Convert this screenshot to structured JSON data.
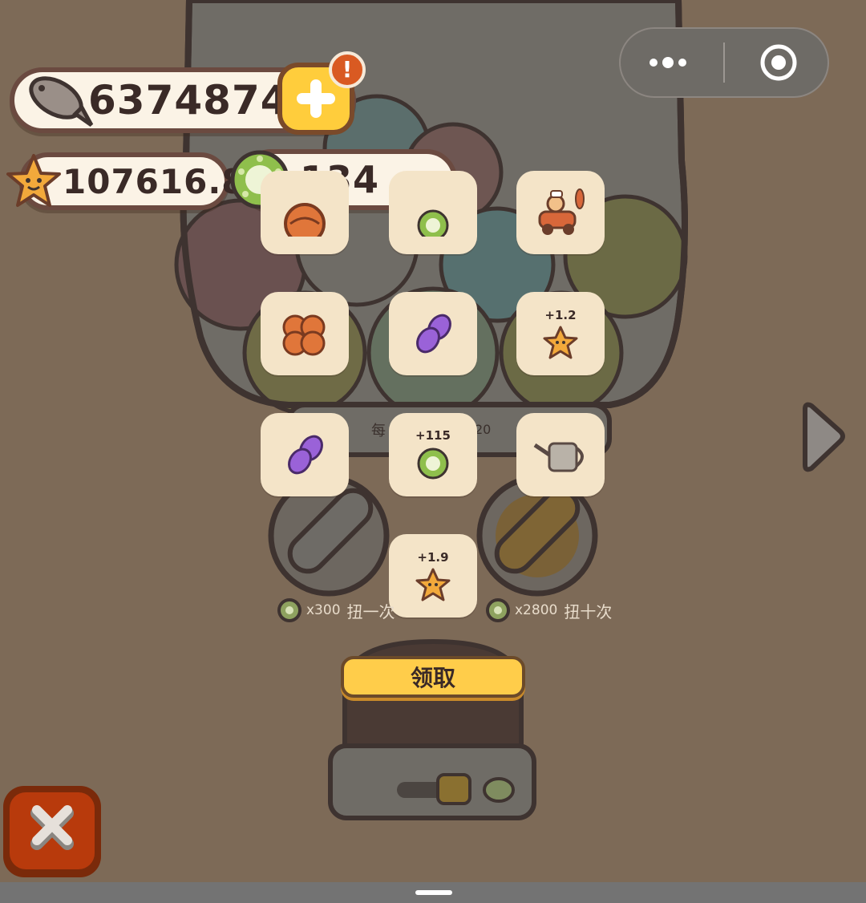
{
  "resources": {
    "fish_count": "6374874",
    "star_count": "107616.8",
    "coin_count": "134",
    "alert_mark": "!"
  },
  "rewards": [
    {
      "id": "r1",
      "icon": "orange-ball-icon",
      "amount": ""
    },
    {
      "id": "r2",
      "icon": "green-coin-icon",
      "amount": ""
    },
    {
      "id": "r3",
      "icon": "dog-car-icon",
      "amount": ""
    },
    {
      "id": "r4",
      "icon": "orange-balls-icon",
      "amount": ""
    },
    {
      "id": "r5",
      "icon": "purple-fish-icon",
      "amount": ""
    },
    {
      "id": "r6",
      "icon": "star-icon",
      "amount": "+1.2"
    },
    {
      "id": "r7",
      "icon": "purple-fish-icon",
      "amount": ""
    },
    {
      "id": "r8",
      "icon": "green-coin-icon",
      "amount": "+115"
    },
    {
      "id": "r9",
      "icon": "watering-can-icon",
      "amount": ""
    },
    {
      "id": "r10",
      "icon": "star-icon",
      "amount": "+1.9"
    }
  ],
  "machine": {
    "counter_left": "每",
    "counter_right": "20",
    "spin_once_cost": "x300",
    "spin_once_label": "扭一次",
    "spin_ten_cost": "x2800",
    "spin_ten_label": "扭十次",
    "claim_label": "领取"
  },
  "colors": {
    "accent_yellow": "#ffcd4a",
    "close_red": "#b83a0c",
    "tile_bg": "#f4e4c8"
  }
}
